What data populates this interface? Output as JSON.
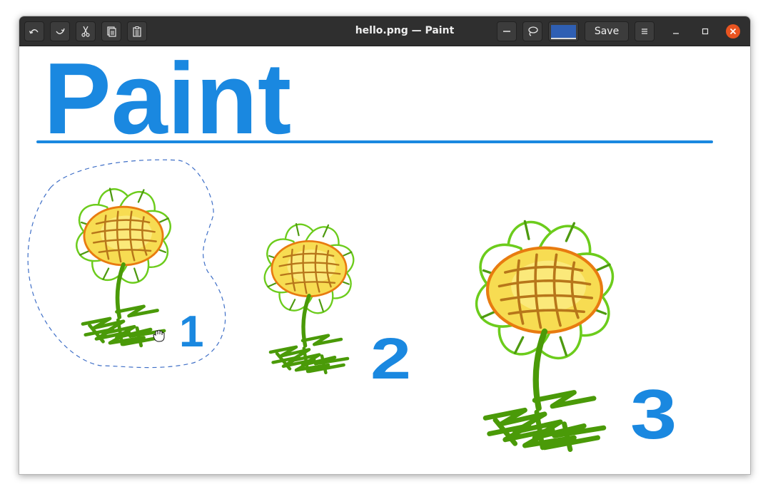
{
  "window": {
    "title": "hello.png — Paint"
  },
  "toolbar": {
    "undo_icon": "undo-icon",
    "redo_icon": "redo-icon",
    "cut_icon": "scissors-icon",
    "copy_icon": "copy-icon",
    "paste_icon": "paste-icon",
    "line_width_icon": "minus-icon",
    "selection_icon": "lasso-icon",
    "save_label": "Save",
    "menu_icon": "hamburger-icon"
  },
  "colors": {
    "headerbar": "#2f2f2f",
    "current_color": "#2f5fb3",
    "close_button": "#e95420",
    "text_blue": "#1a88e0",
    "petal_green": "#6ccc1c",
    "stem_green": "#4a9a08",
    "center_yellow": "#f7dc52",
    "center_orange": "#e87b10",
    "seed_brown": "#b7761a",
    "selection_dash": "#3f6fc7"
  },
  "canvas": {
    "heading": "Paint",
    "label_1": "1",
    "label_2": "2",
    "label_3": "3"
  }
}
